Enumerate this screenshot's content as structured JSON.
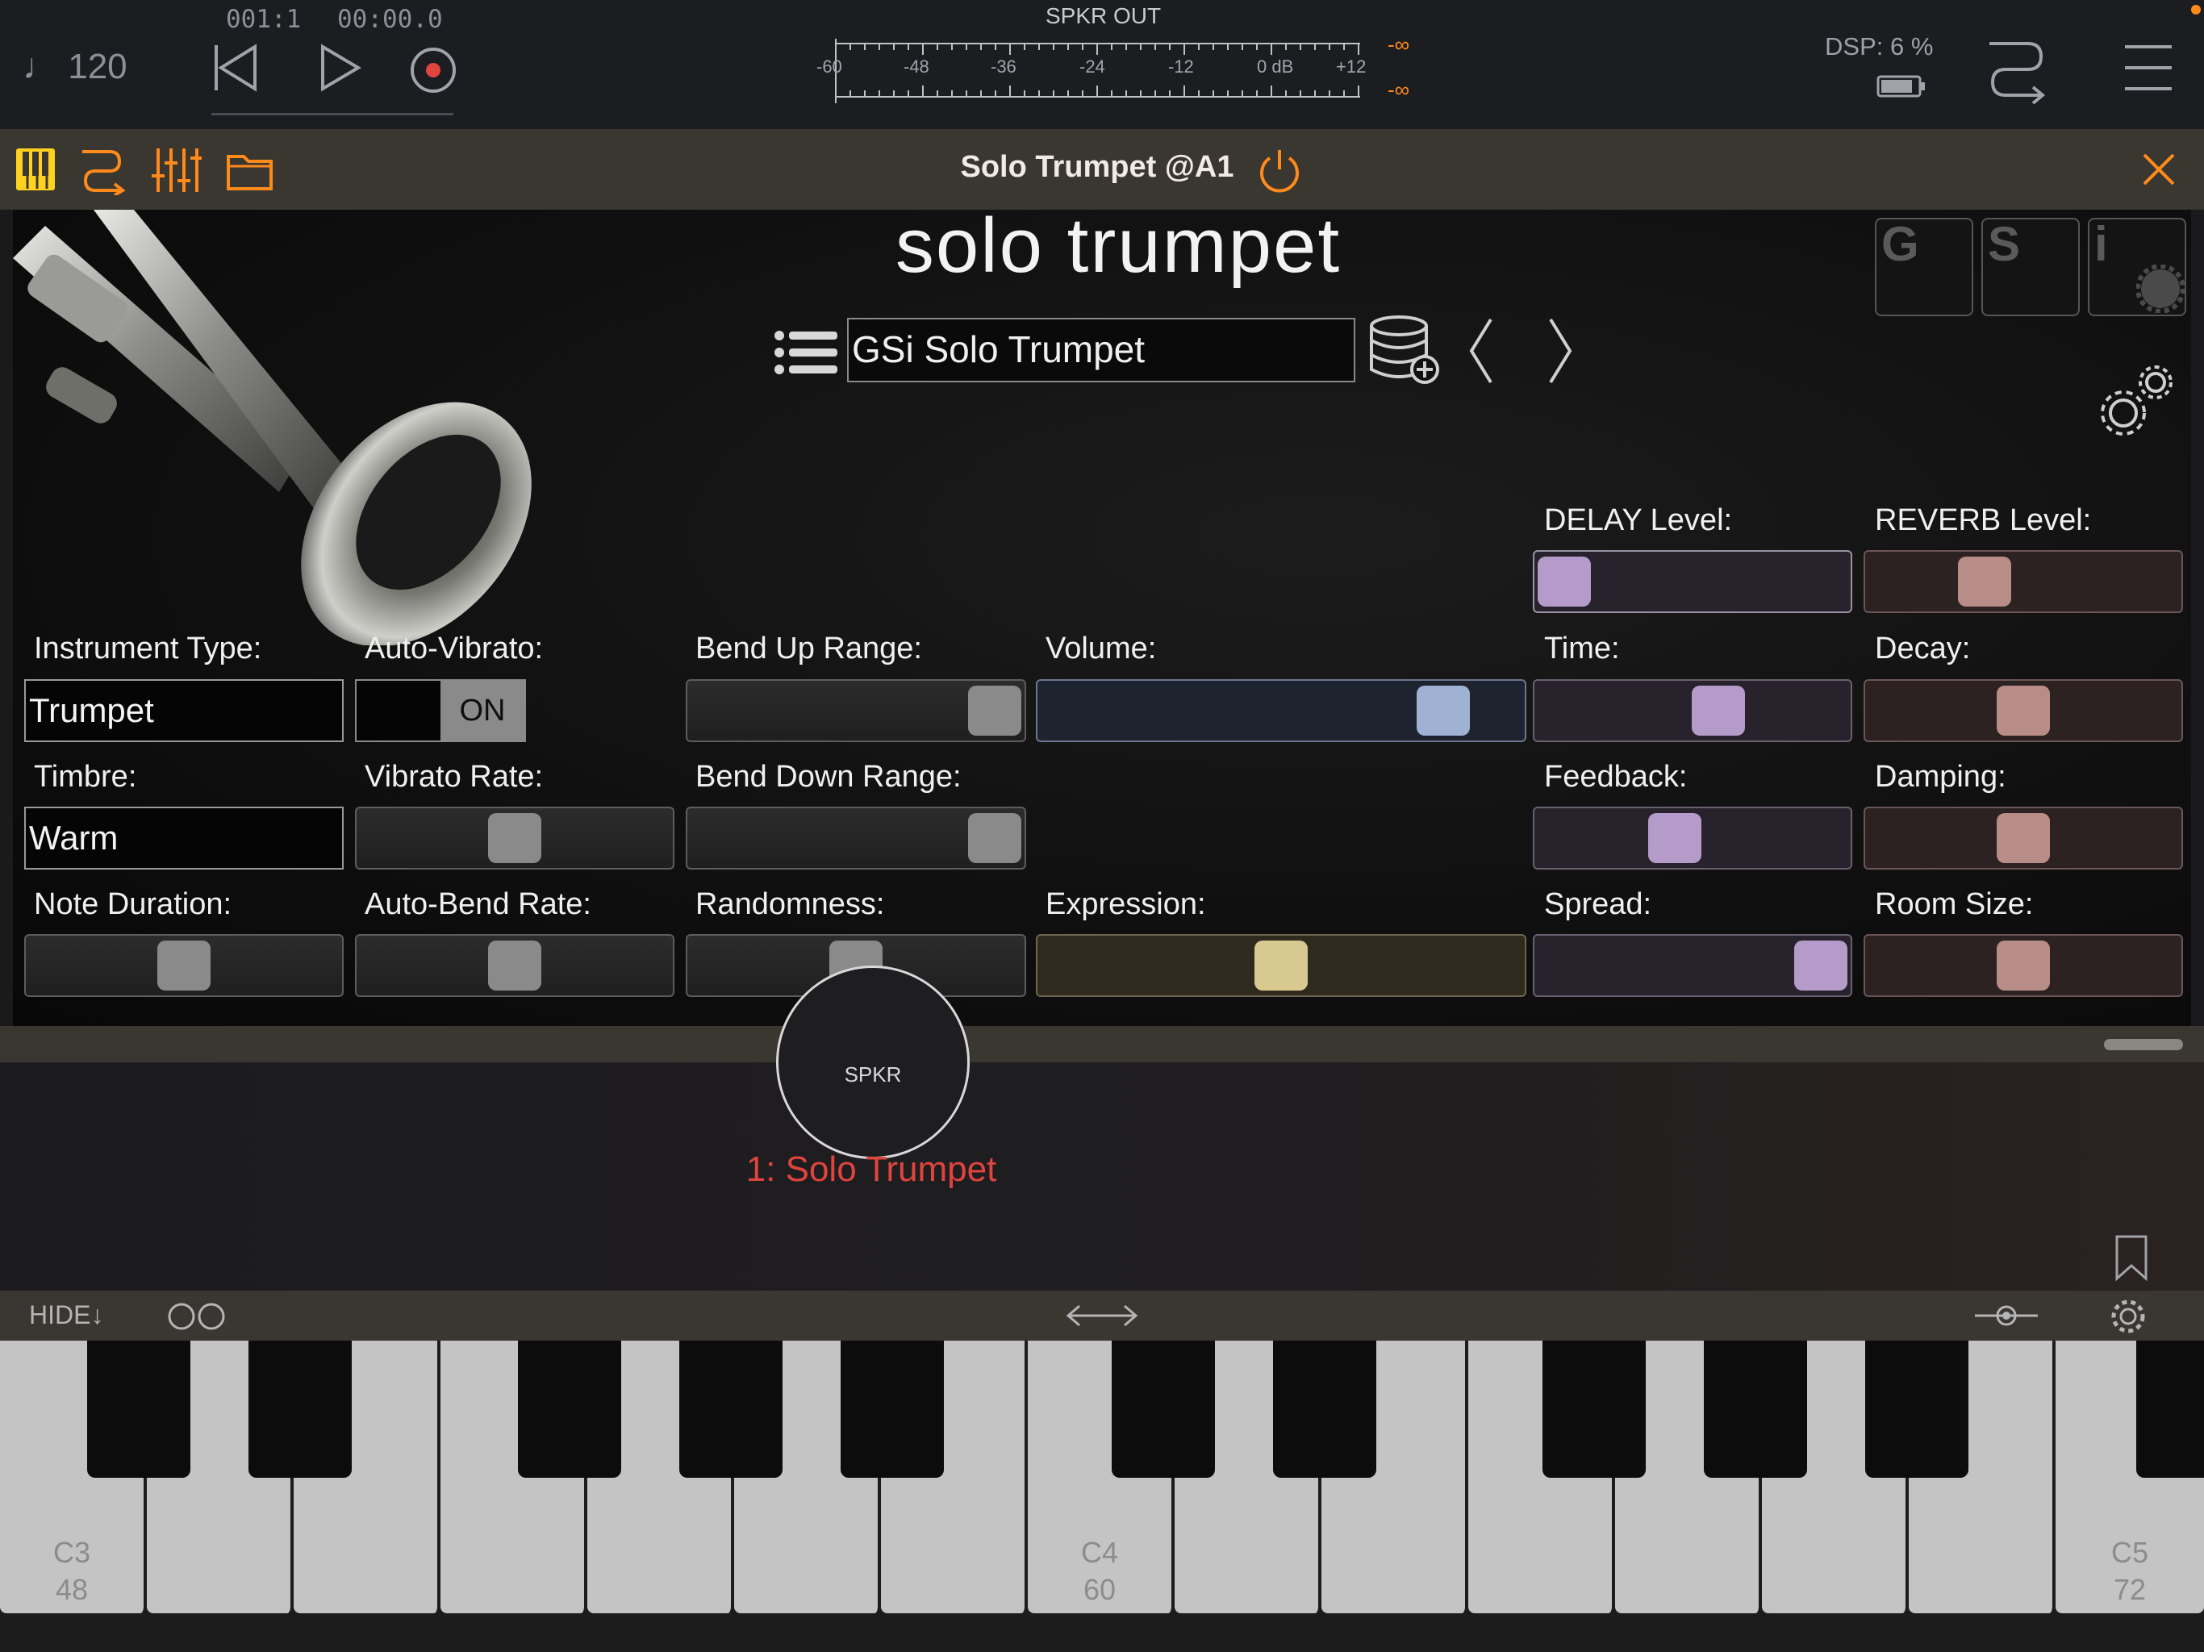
{
  "transport": {
    "tempo": "120",
    "position_bars": "001:1",
    "position_time": "00:00.0",
    "meter_title": "SPKR OUT",
    "meter_scale": [
      "-60",
      "-48",
      "-36",
      "-24",
      "-12",
      "0 dB",
      "+12"
    ],
    "meter_peak_left": "-∞",
    "meter_peak_right": "-∞",
    "dsp_label": "DSP:",
    "dsp_value": "6 %"
  },
  "plugin": {
    "title": "Solo Trumpet @A1",
    "product_name": "solo trumpet",
    "preset_name": "GSi Solo Trumpet",
    "brand_letters": [
      "G",
      "S",
      "i"
    ]
  },
  "controls": {
    "instrument_type": {
      "label": "Instrument Type:",
      "value": "Trumpet"
    },
    "auto_vibrato": {
      "label": "Auto-Vibrato:",
      "value": "ON"
    },
    "timbre": {
      "label": "Timbre:",
      "value": "Warm"
    },
    "vibrato_rate": {
      "label": "Vibrato Rate:",
      "level": 0.5
    },
    "note_duration": {
      "label": "Note Duration:",
      "level": 0.5
    },
    "auto_bend_rate": {
      "label": "Auto-Bend Rate:",
      "level": 0.5
    },
    "bend_up_range": {
      "label": "Bend Up Range:",
      "level": 1.0
    },
    "bend_down_range": {
      "label": "Bend Down Range:",
      "level": 1.0
    },
    "randomness": {
      "label": "Randomness:",
      "level": 0.5
    },
    "volume": {
      "label": "Volume:",
      "level": 0.88
    },
    "expression": {
      "label": "Expression:",
      "level": 0.5
    },
    "delay_level": {
      "label": "DELAY Level:",
      "level": 0.0
    },
    "reverb_level": {
      "label": "REVERB Level:",
      "level": 0.35
    },
    "time": {
      "label": "Time:",
      "level": 0.6
    },
    "feedback": {
      "label": "Feedback:",
      "level": 0.43
    },
    "spread": {
      "label": "Spread:",
      "level": 1.0
    },
    "decay": {
      "label": "Decay:",
      "level": 0.5
    },
    "damping": {
      "label": "Damping:",
      "level": 0.5
    },
    "room_size": {
      "label": "Room Size:",
      "level": 0.5
    }
  },
  "mixer": {
    "output_node": "SPKR",
    "track_label": "1: Solo Trumpet"
  },
  "keyboard": {
    "hide_label": "HIDE",
    "octave_labels": [
      {
        "note": "C3",
        "midi": "48"
      },
      {
        "note": "C4",
        "midi": "60"
      },
      {
        "note": "C5",
        "midi": "72"
      }
    ]
  },
  "colors": {
    "accent_orange": "#ff8a1c",
    "track_red": "#e0443e",
    "keyboard_white": "#c4c4c4"
  }
}
